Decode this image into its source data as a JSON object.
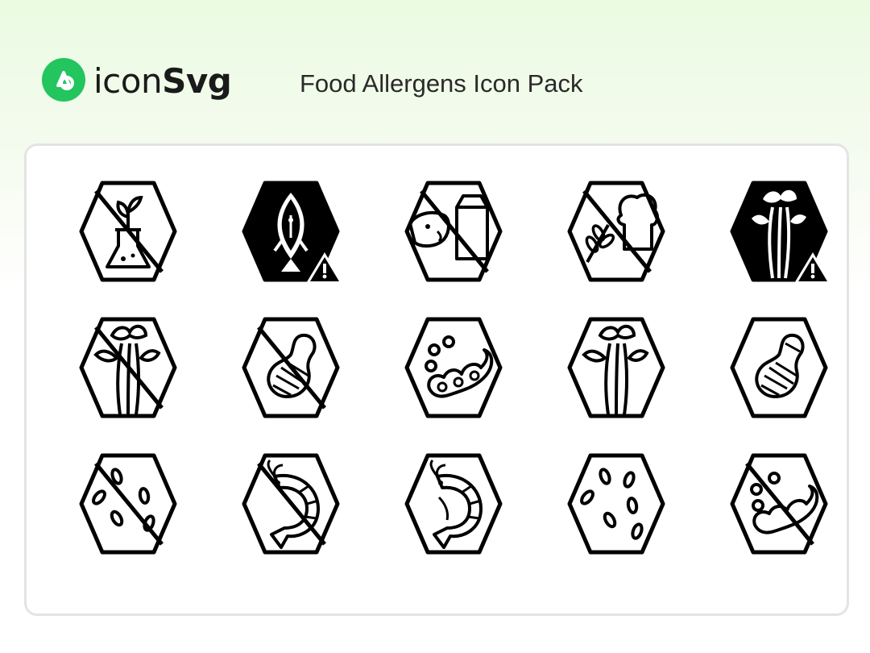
{
  "brand": {
    "name_light": "icon",
    "name_bold": "Svg",
    "accent_color": "#22c55e"
  },
  "title": "Food Allergens Icon Pack",
  "icons": [
    {
      "name": "no-soy-plant-flask-icon"
    },
    {
      "name": "fish-warning-icon"
    },
    {
      "name": "no-dairy-cow-milk-icon"
    },
    {
      "name": "no-gluten-wheat-bread-icon"
    },
    {
      "name": "celery-warning-icon"
    },
    {
      "name": "no-celery-icon"
    },
    {
      "name": "no-peanut-icon"
    },
    {
      "name": "soybean-icon"
    },
    {
      "name": "celery-icon"
    },
    {
      "name": "peanut-icon"
    },
    {
      "name": "no-sesame-icon"
    },
    {
      "name": "no-shrimp-icon"
    },
    {
      "name": "shrimp-icon"
    },
    {
      "name": "sesame-icon"
    },
    {
      "name": "no-soybean-icon"
    }
  ]
}
